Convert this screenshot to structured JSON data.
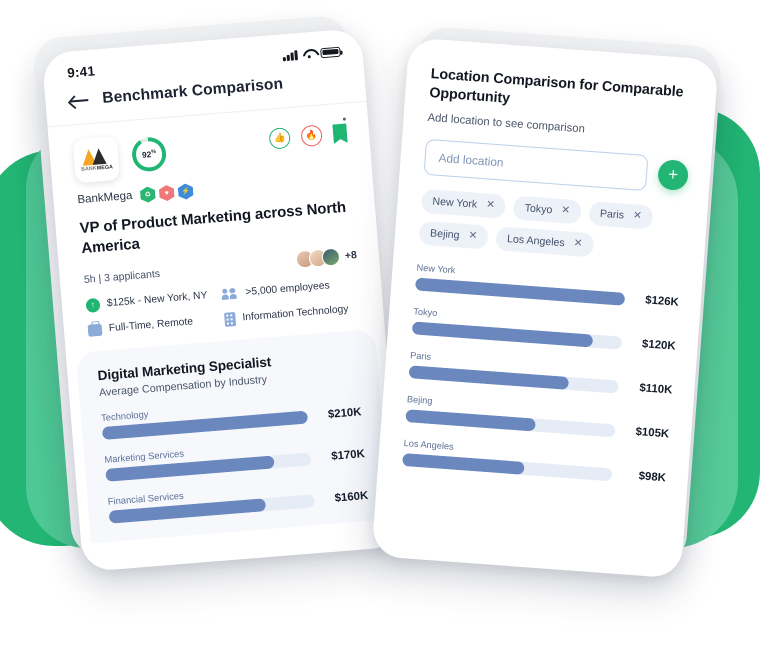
{
  "left_phone": {
    "status_bar": {
      "time": "9:41",
      "signal_icon": "cellular-signal-icon",
      "wifi_icon": "wifi-icon",
      "battery_icon": "battery-icon"
    },
    "nav": {
      "back_icon": "back-arrow-icon",
      "title": "Benchmark Comparison"
    },
    "job": {
      "logo_word_1": "BANK",
      "logo_word_2": "MEGA",
      "match_score": "92",
      "match_unit": "%",
      "reactions": [
        {
          "name": "thumbs-up-icon",
          "glyph": "👍",
          "color": "#23b472"
        },
        {
          "name": "fire-icon",
          "glyph": "🔥",
          "color": "#ef5a5a"
        }
      ],
      "bookmark_icon": "bookmark-icon",
      "more_icon": "more-options-icon",
      "company": "BankMega",
      "badges": [
        {
          "name": "badge-green-icon",
          "color": "g",
          "glyph": "♻"
        },
        {
          "name": "badge-red-icon",
          "color": "r",
          "glyph": "♥"
        },
        {
          "name": "badge-blue-icon",
          "color": "b",
          "glyph": "⚡"
        }
      ],
      "title": "VP of Product Marketing across North America",
      "applicants": "5h | 3 applicants",
      "avatar_overflow": "+8",
      "meta": [
        {
          "icon": "salary-icon",
          "text": "$125k - New York, NY"
        },
        {
          "icon": "employees-icon",
          "text": ">5,000 employees"
        },
        {
          "icon": "briefcase-icon",
          "text": "Full-Time, Remote"
        },
        {
          "icon": "industry-icon",
          "text": "Information Technology"
        }
      ]
    }
  },
  "right_phone": {
    "title": "Location Comparison for Comparable Opportunity",
    "subtitle": "Add location to see comparison",
    "input_placeholder": "Add location",
    "add_button_label": "+",
    "chips": [
      {
        "label": "New York",
        "remove": "✕"
      },
      {
        "label": "Tokyo",
        "remove": "✕"
      },
      {
        "label": "Paris",
        "remove": "✕"
      },
      {
        "label": "Bejing",
        "remove": "✕"
      },
      {
        "label": "Los Angeles",
        "remove": "✕"
      }
    ]
  },
  "colors": {
    "brand_green": "#22b573",
    "blob_green_light": "#4ec894",
    "bar_blue": "#6a88bd",
    "bar_track": "#e6ecf5",
    "panel_bg": "#f6f8fc"
  },
  "chart_data": [
    {
      "type": "bar",
      "title": "Digital Marketing Specialist",
      "subtitle": "Average Compensation by Industry",
      "orientation": "horizontal",
      "categories": [
        "Technology",
        "Marketing Services",
        "Financial Services"
      ],
      "values": [
        210,
        170,
        160
      ],
      "labels": [
        "$210K",
        "$170K",
        "$160K"
      ],
      "percent": [
        100,
        82,
        76
      ],
      "xlabel": "",
      "ylabel": "",
      "max": 210,
      "grid": false,
      "legend": "none"
    },
    {
      "type": "bar",
      "title": "Location Comparison for Comparable Opportunity",
      "subtitle": "",
      "orientation": "horizontal",
      "categories": [
        "New York",
        "Tokyo",
        "Paris",
        "Bejing",
        "Los Angeles"
      ],
      "values": [
        126,
        120,
        110,
        105,
        98
      ],
      "labels": [
        "$126K",
        "$120K",
        "$110K",
        "$105K",
        "$98K"
      ],
      "percent": [
        100,
        86,
        76,
        62,
        58
      ],
      "xlabel": "",
      "ylabel": "",
      "max": 126,
      "grid": false,
      "legend": "none"
    }
  ]
}
